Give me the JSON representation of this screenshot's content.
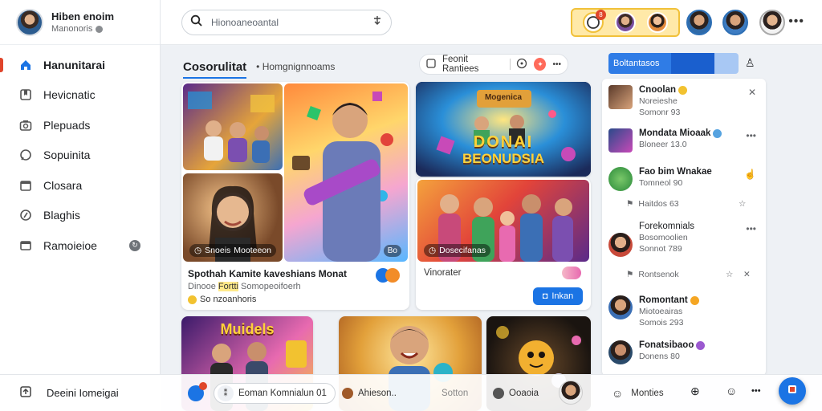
{
  "profile": {
    "name": "Hiben enoim",
    "subtitle": "Manonoris"
  },
  "sidebar": {
    "items": [
      {
        "label": "Hanunitarai",
        "icon": "home-icon",
        "active": true
      },
      {
        "label": "Hevicnatic",
        "icon": "bookmark-icon"
      },
      {
        "label": "Plepuads",
        "icon": "camera-icon"
      },
      {
        "label": "Sopuinita",
        "icon": "chat-icon"
      },
      {
        "label": "Closara",
        "icon": "calendar-icon"
      },
      {
        "label": "Blaghis",
        "icon": "blog-icon"
      },
      {
        "label": "Ramoieioe",
        "icon": "window-icon",
        "badge": "↻"
      }
    ],
    "footer_label": "Deeini Iomeigai"
  },
  "search": {
    "placeholder": "Hionoaneoantal"
  },
  "topbar": {
    "notification_badge": "8"
  },
  "main": {
    "tab_active": "Cosorulitat",
    "tab_sub": "• Homgnignnoams",
    "pill_label": "Feonit Rantiees",
    "card1": {
      "title": "Spothah Kamite kaveshians Monat",
      "subtitle_a": "Dinooe",
      "subtitle_highlight": "Fortti",
      "subtitle_b": "Somopeoifoerh",
      "meta": "So nzoanhoris",
      "chip_a": "Snoeis",
      "chip_b": "Mooteeon",
      "chip_c": "Bo"
    },
    "card2": {
      "banner_top": "Mogenica",
      "banner_big": "DONAI",
      "banner_big2": "BEONUDSIA",
      "chip": "Dosecifanas",
      "label": "Vinorater",
      "button": "Inkan"
    },
    "card3": {
      "banner": "Muidels"
    }
  },
  "right": {
    "tab_label": "Boltantasos",
    "items": [
      {
        "name": "Cnoolan",
        "sub": "Noreieshe",
        "sub2": "Somonr 93",
        "emoji_color": "#f2c230"
      },
      {
        "name": "Mondata Mioaak",
        "sub": "Bloneer 13.0",
        "emoji_color": "#56a3e0"
      },
      {
        "name": "Fao bim Wnakae",
        "sub": "Tomneol 90",
        "sub_row": "Haitdos 63",
        "emoji_color": ""
      },
      {
        "name": "Forekomnials",
        "sub": "Bosomoolien",
        "sub2": "Sonnot 789",
        "sub_row": "Rontsenok",
        "emoji_color": ""
      },
      {
        "name": "Romontant",
        "sub": "Miotoeairas",
        "sub2": "Somois 293",
        "emoji_color": "#f5a623"
      },
      {
        "name": "Fonatsibaoo",
        "sub": "Donens 80",
        "emoji_color": "#9b59d0"
      }
    ]
  },
  "bottom": {
    "item1": "Eoman Komnialun 01",
    "item2": "Ahieson..",
    "item3": "Sotton",
    "item4": "Ooaoia",
    "item5": "Monties"
  },
  "colors": {
    "accent": "#1b74e4",
    "active_marker": "#e0452b",
    "highlight": "#ffe9a8"
  }
}
